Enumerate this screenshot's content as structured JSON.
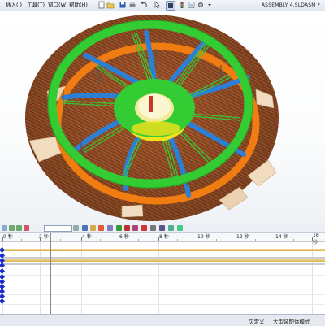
{
  "menubar": {
    "items": [
      "插入(I)",
      "工具(T)",
      "窗口(W)",
      "帮助(H)"
    ],
    "document_title": "ASSEMBLY 4.SLDASM *"
  },
  "toolbar": {
    "buttons": [
      "new-document-icon",
      "open-icon",
      "save-icon",
      "print-icon",
      "undo-icon",
      "select-icon",
      "rebuild-icon",
      "options-icon"
    ]
  },
  "timeline": {
    "time_field_value": "",
    "ruler_labels": [
      "0 秒",
      "2 秒",
      "4 秒",
      "6 秒",
      "8 秒",
      "10 秒",
      "12 秒",
      "14 秒",
      "16 秒"
    ],
    "controls": [
      "calculate-icon",
      "play-from-start-icon",
      "play-icon",
      "stop-icon",
      "playback-speed-icon",
      "save-animation-icon",
      "animation-wizard-icon",
      "autokey-icon",
      "add-key-icon",
      "motor-icon",
      "spring-icon",
      "damper-icon",
      "force-icon",
      "contact-icon",
      "gravity-icon",
      "results-icon",
      "properties-icon"
    ]
  },
  "statusbar": {
    "user": "欠定义",
    "mode": "大型装配体模式"
  },
  "colors": {
    "green_rim": "#33cc33",
    "orange_ring": "#f07c12",
    "blue_spoke": "#2b7fd4",
    "wood": "#a5552a",
    "hub_yellow": "#f2e21a",
    "keyframe": "#1a2ccf",
    "timeline_gold": "#e3ba5c"
  }
}
